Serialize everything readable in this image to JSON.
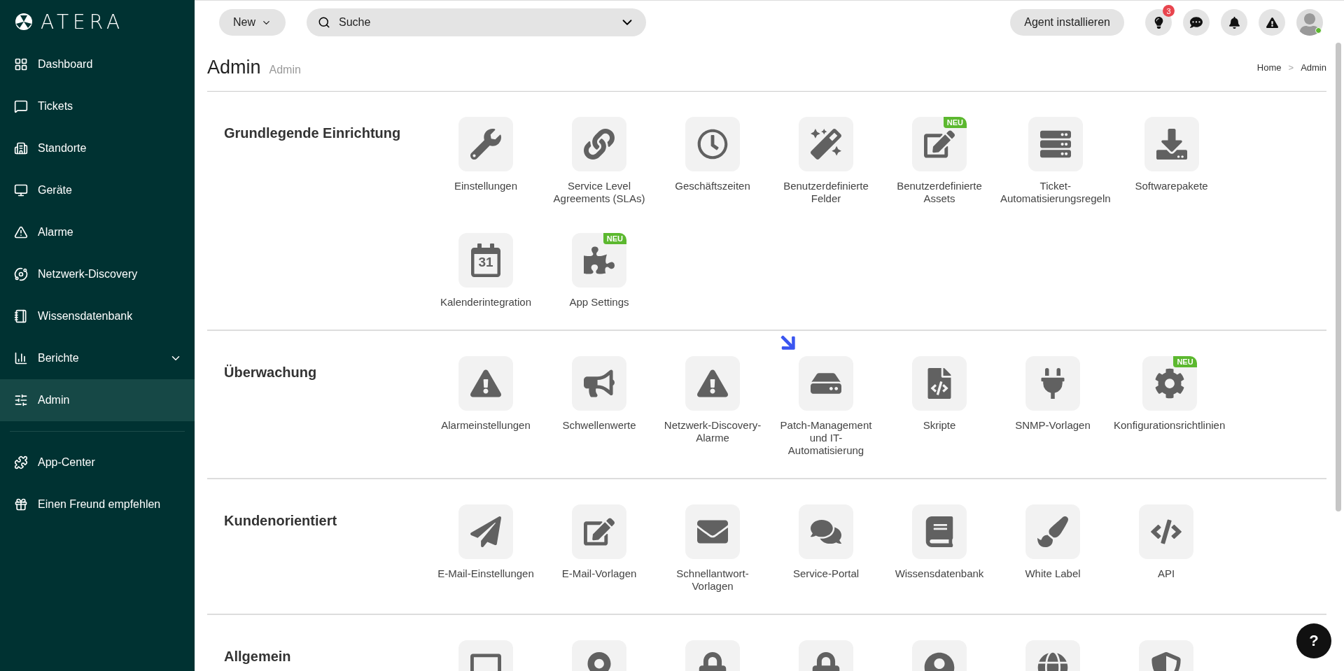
{
  "brand": {
    "name": "ATERA"
  },
  "sidebar": {
    "items": [
      {
        "label": "Dashboard",
        "selected": false
      },
      {
        "label": "Tickets",
        "selected": false
      },
      {
        "label": "Standorte",
        "selected": false
      },
      {
        "label": "Geräte",
        "selected": false
      },
      {
        "label": "Alarme",
        "selected": false
      },
      {
        "label": "Netzwerk-Discovery",
        "selected": false
      },
      {
        "label": "Wissensdatenbank",
        "selected": false
      },
      {
        "label": "Berichte",
        "selected": false,
        "expanded": false
      },
      {
        "label": "Admin",
        "selected": true
      }
    ],
    "footer_items": [
      {
        "label": "App-Center",
        "selected": false
      },
      {
        "label": "Einen Freund empfehlen",
        "selected": false
      }
    ]
  },
  "topbar": {
    "new_button": "New",
    "search": {
      "placeholder": "Suche"
    },
    "agent_button": "Agent installieren",
    "notification_badge": "3",
    "user_online": true
  },
  "page": {
    "title": "Admin",
    "subtitle": "Admin",
    "breadcrumb": [
      "Home",
      "Admin"
    ],
    "breadcrumb_separator": ">"
  },
  "sections": [
    {
      "title": "Grundlegende Einrichtung",
      "tiles": [
        {
          "label": "Einstellungen"
        },
        {
          "label": "Service Level Agreements (SLAs)"
        },
        {
          "label": "Geschäftszeiten"
        },
        {
          "label": "Benutzerdefinierte Felder"
        },
        {
          "label": "Benutzerdefinierte Assets",
          "badge": "NEU"
        },
        {
          "label": "Ticket-Automatisierungsregeln"
        },
        {
          "label": "Softwarepakete"
        },
        {
          "label": "Kalenderintegration",
          "icon_text": "31"
        },
        {
          "label": "App Settings",
          "badge": "NEU"
        }
      ]
    },
    {
      "title": "Überwachung",
      "tiles": [
        {
          "label": "Alarmeinstellungen"
        },
        {
          "label": "Schwellenwerte"
        },
        {
          "label": "Netzwerk-Discovery-Alarme"
        },
        {
          "label": "Patch-Management und IT-Automatisierung",
          "pointer": true
        },
        {
          "label": "Skripte"
        },
        {
          "label": "SNMP-Vorlagen"
        },
        {
          "label": "Konfigurationsrichtlinien",
          "badge": "NEU"
        }
      ]
    },
    {
      "title": "Kundenorientiert",
      "tiles": [
        {
          "label": "E-Mail-Einstellungen"
        },
        {
          "label": "E-Mail-Vorlagen"
        },
        {
          "label": "Schnellantwort-Vorlagen"
        },
        {
          "label": "Service-Portal"
        },
        {
          "label": "Wissensdatenbank"
        },
        {
          "label": "White Label"
        },
        {
          "label": "API"
        }
      ]
    },
    {
      "title": "Allgemein"
    }
  ],
  "help_button": "?"
}
